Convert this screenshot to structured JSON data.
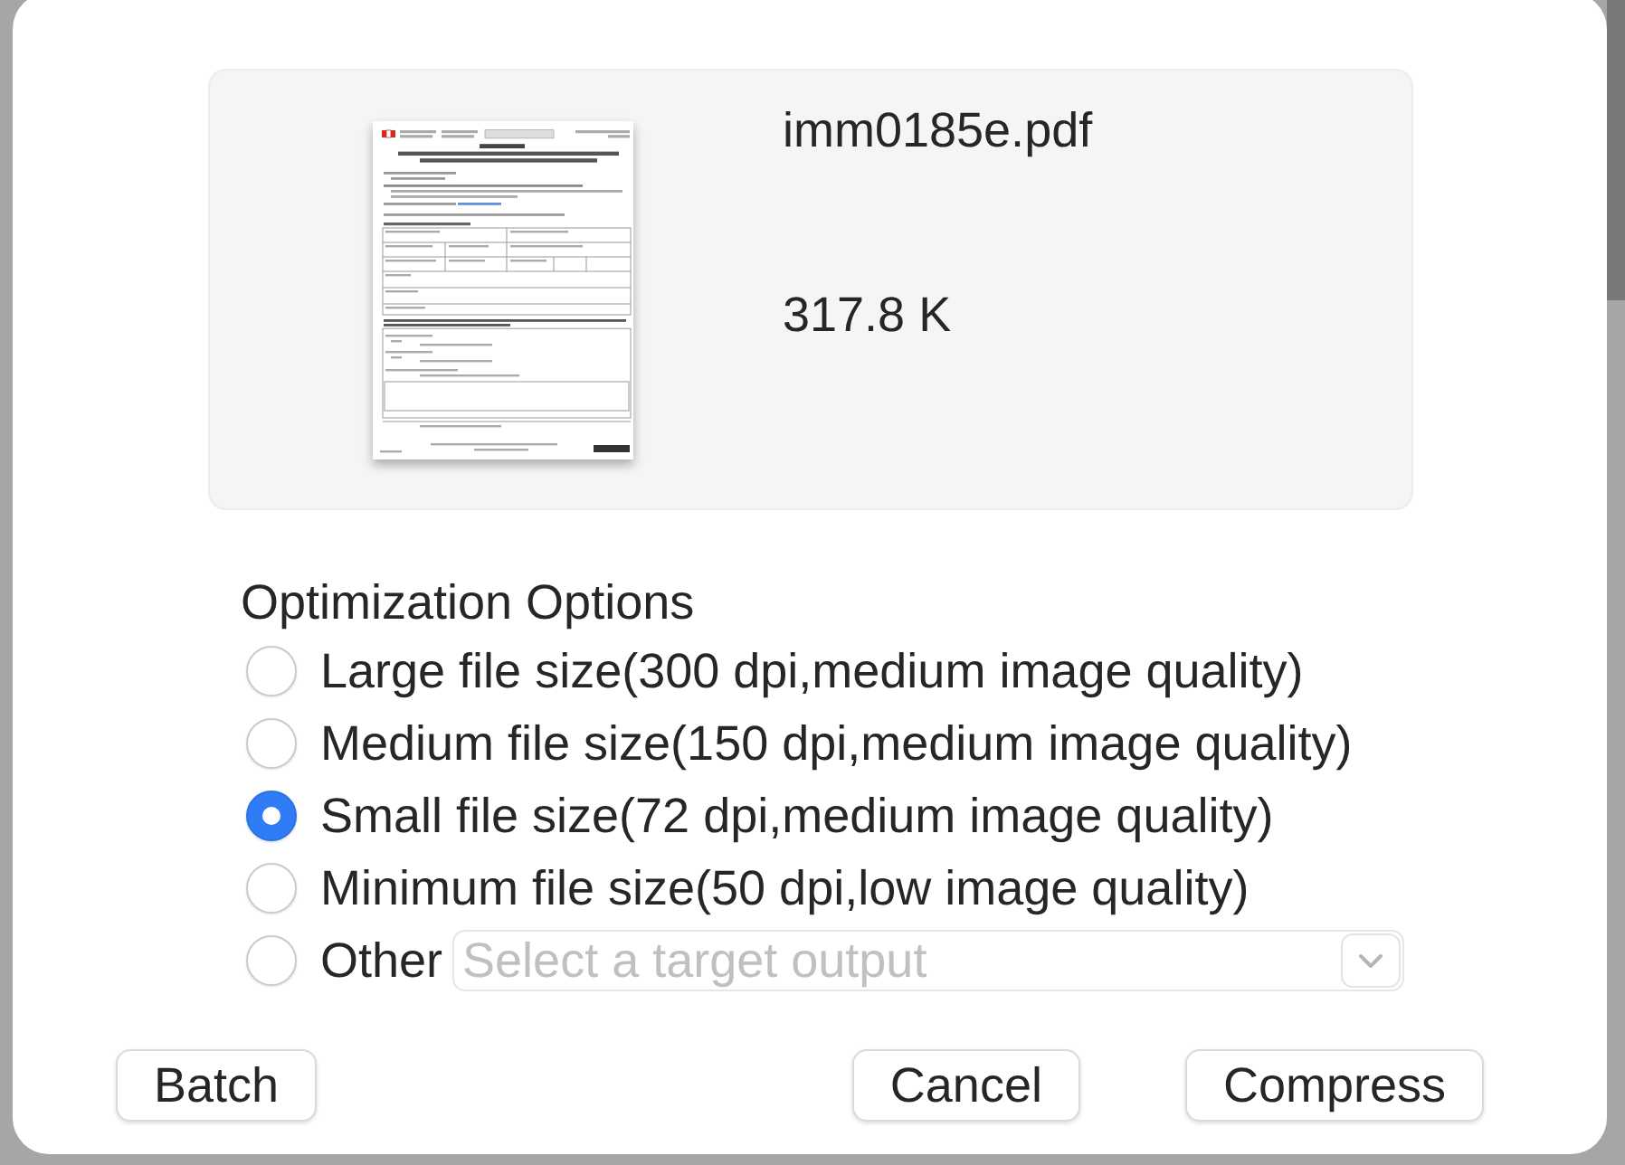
{
  "preview": {
    "file_name": "imm0185e.pdf",
    "file_size": "317.8 K"
  },
  "options": {
    "title": "Optimization Options",
    "items": [
      {
        "kind": "radio",
        "label": "Large file size(300 dpi,medium image quality)",
        "selected": false
      },
      {
        "kind": "radio",
        "label": "Medium file size(150 dpi,medium image quality)",
        "selected": false
      },
      {
        "kind": "radio",
        "label": "Small file size(72 dpi,medium image quality)",
        "selected": true
      },
      {
        "kind": "radio",
        "label": "Minimum file size(50 dpi,low image quality)",
        "selected": false
      },
      {
        "kind": "radio_select",
        "label": "Other",
        "selected": false,
        "placeholder": "Select a target output"
      }
    ]
  },
  "buttons": {
    "left": [
      {
        "label": "Batch"
      }
    ],
    "right": [
      {
        "label": "Cancel"
      },
      {
        "label": "Compress"
      }
    ]
  }
}
